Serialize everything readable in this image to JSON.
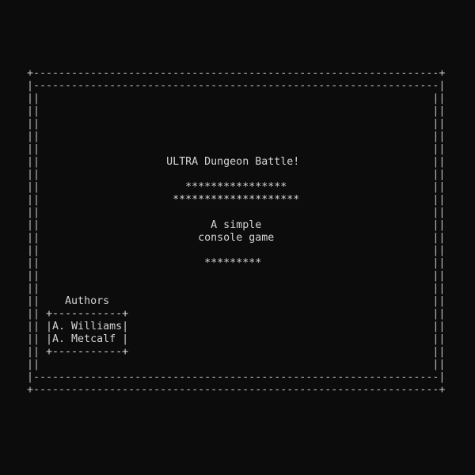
{
  "title": "ULTRA Dungeon Battle!",
  "stars_line_1": "****************",
  "stars_line_2": "********************",
  "tagline_line_1": "A simple",
  "tagline_line_2": "console game",
  "stars_line_3": "*********",
  "authors_heading": "Authors",
  "authors_box_top": "+-----------+",
  "authors": [
    "|A. Williams|",
    "|A. Metcalf |"
  ],
  "authors_box_bottom": "+-----------+",
  "frame": {
    "outer_edge": "+----------------------------------------------------------------+",
    "inner_edge": "|----------------------------------------------------------------|",
    "side_left": "||",
    "side_right": "||"
  }
}
